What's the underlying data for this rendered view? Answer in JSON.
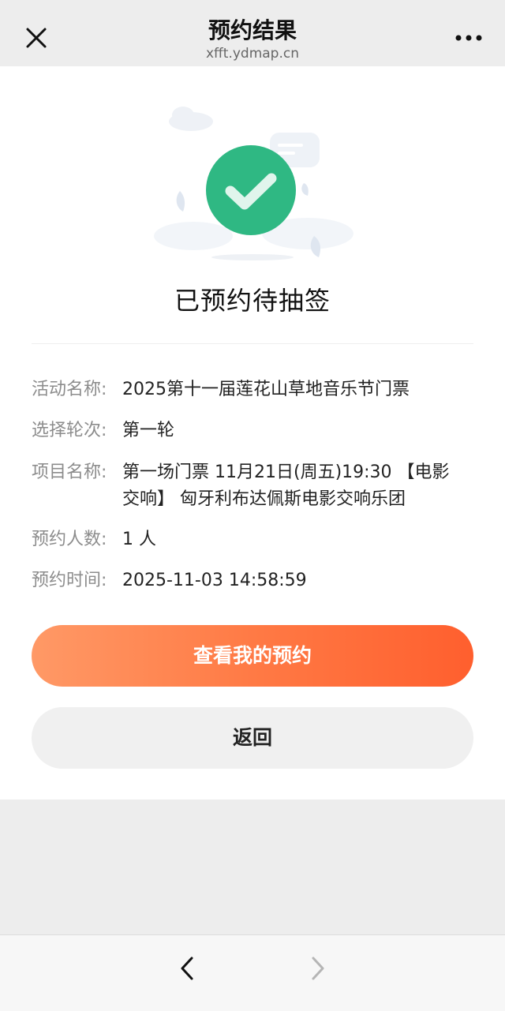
{
  "header": {
    "title": "预约结果",
    "domain": "xfft.ydmap.cn"
  },
  "status": {
    "text": "已预约待抽签"
  },
  "details": [
    {
      "label": "活动名称:",
      "value": "2025第十一届莲花山草地音乐节门票"
    },
    {
      "label": "选择轮次:",
      "value": "第一轮"
    },
    {
      "label": "项目名称:",
      "value": "第一场门票 11月21日(周五)19:30 【电影交响】 匈牙利布达佩斯电影交响乐团"
    },
    {
      "label": "预约人数:",
      "value": "1 人"
    },
    {
      "label": "预约时间:",
      "value": "2025-11-03 14:58:59"
    }
  ],
  "actions": {
    "view_label": "查看我的预约",
    "back_label": "返回"
  },
  "colors": {
    "success": "#2fb883",
    "accent_start": "#ff9966",
    "accent_end": "#ff5f2e"
  },
  "icons": {
    "close": "close-icon",
    "more": "more-icon",
    "nav_back": "chevron-left-icon",
    "nav_forward": "chevron-right-icon",
    "status": "check-circle-icon"
  }
}
